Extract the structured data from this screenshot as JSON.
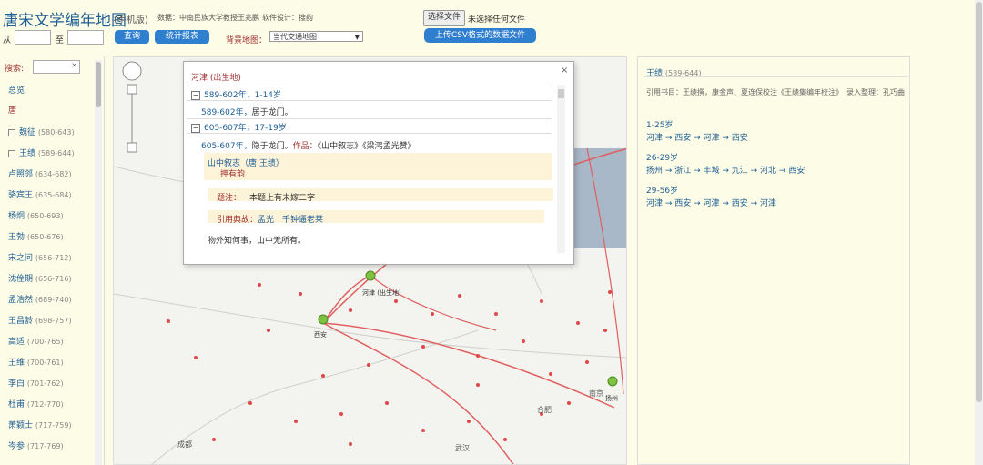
{
  "header": {
    "title": "唐宋文学编年地图",
    "mobile": "(手机版)",
    "credit_data": "数据：中南民族大学教授王兆鹏",
    "credit_design": "软件设计：搜韵",
    "choose_file": "选择文件",
    "file_status": "未选择任何文件",
    "upload": "上传CSV格式的数据文件",
    "from": "从",
    "to": "至",
    "query": "查询",
    "report": "统计报表",
    "bg_label": "背景地图：",
    "bg_value": "当代交通地图"
  },
  "sidebar": {
    "search_label": "搜索:",
    "clear": "×",
    "overview": "总览",
    "dynasty": "唐",
    "poets": [
      {
        "name": "魏征",
        "years": "(580-643)",
        "check": true
      },
      {
        "name": "王绩",
        "years": "(589-644)",
        "check": true
      },
      {
        "name": "卢照邻",
        "years": "(634-682)",
        "check": false
      },
      {
        "name": "骆宾王",
        "years": "(635-684)",
        "check": false
      },
      {
        "name": "杨炯",
        "years": "(650-693)",
        "check": false
      },
      {
        "name": "王勃",
        "years": "(650-676)",
        "check": false
      },
      {
        "name": "宋之问",
        "years": "(656-712)",
        "check": false
      },
      {
        "name": "沈佺期",
        "years": "(656-716)",
        "check": false
      },
      {
        "name": "孟浩然",
        "years": "(689-740)",
        "check": false
      },
      {
        "name": "王昌龄",
        "years": "(698-757)",
        "check": false
      },
      {
        "name": "高适",
        "years": "(700-765)",
        "check": false
      },
      {
        "name": "王维",
        "years": "(700-761)",
        "check": false
      },
      {
        "name": "李白",
        "years": "(701-762)",
        "check": false
      },
      {
        "name": "杜甫",
        "years": "(712-770)",
        "check": false
      },
      {
        "name": "萧颖士",
        "years": "(717-759)",
        "check": false
      },
      {
        "name": "岑参",
        "years": "(717-769)",
        "check": false
      }
    ]
  },
  "map": {
    "labels": {
      "hejin": "河津 (出生地)",
      "xian": "西安",
      "yangzhou": "扬州",
      "chengdu": "成都",
      "wuhan": "武汉",
      "hefei": "合肥",
      "nanjing": "南京"
    }
  },
  "popup": {
    "close": "×",
    "place": "河津 (出生地)",
    "sec1": "589-602年，1-14岁",
    "e1_year": "589-602年，",
    "e1_text": "居于龙门。",
    "sec2": "605-607年，17-19岁",
    "e2_year": "605-607年，",
    "e2_text": "隐于龙门。",
    "e2_works_label": "作品：",
    "e2_works": "《山中叙志》《梁鸿孟光赞》",
    "poem_title": "山中叙志（唐·王绩）",
    "poem_rhyme": "押有韵",
    "note1_label": "题注：",
    "note1_text": "一本题上有未嫁二字",
    "note2_label": "引用典故：",
    "note2_text": "孟光　千钟逼老莱",
    "poem_line": "物外知何事，山中无所有。"
  },
  "info": {
    "name": "王绩",
    "years": "(589-644)",
    "cite": "引用书目：王绩撰，康金声、夏连保校注《王绩集编年校注》　录入整理：孔巧曲",
    "ranges": [
      {
        "label": "1-25岁",
        "route": "河津 → 西安 → 河津 → 西安"
      },
      {
        "label": "26-29岁",
        "route": "扬州 → 浙江 → 丰城 → 九江 → 河北 → 西安"
      },
      {
        "label": "29-56岁",
        "route": "河津 → 西安 → 河津 → 西安 → 河津"
      }
    ]
  },
  "colors": {
    "accent_blue": "#2f7fd0",
    "link_blue": "#1f5f96",
    "label_red": "#a03030",
    "page_bg": "#fdfce6",
    "route_line": "#e06060"
  }
}
